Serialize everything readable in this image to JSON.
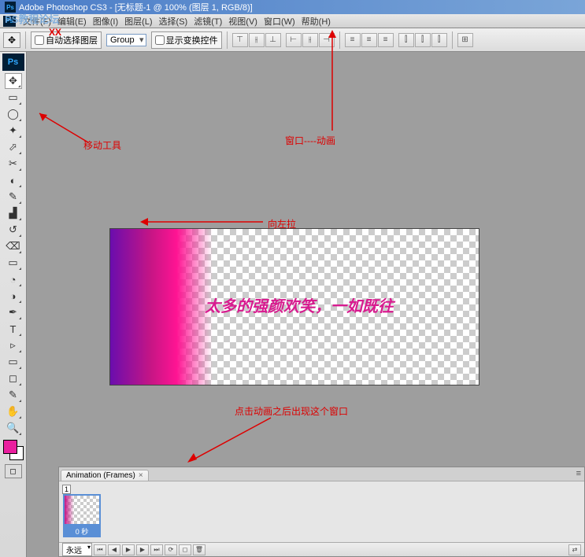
{
  "title_bar": {
    "text": "Adobe Photoshop CS3 - [无标题-1 @ 100% (图层 1, RGB/8)]"
  },
  "watermark": "PS教程论坛",
  "xx_label": "XX",
  "menu": {
    "items": [
      "文件(F)",
      "编辑(E)",
      "图像(I)",
      "图层(L)",
      "选择(S)",
      "滤镜(T)",
      "视图(V)",
      "窗口(W)",
      "帮助(H)"
    ]
  },
  "options_bar": {
    "auto_select_label": "自动选择图层",
    "group_select": "Group",
    "show_transform_label": "显示变换控件"
  },
  "tools": {
    "list": [
      "▣",
      "▥",
      "◇",
      "✦",
      "⬀",
      "✂",
      "✎",
      "⌫",
      "⟋",
      "⟍",
      "▟",
      "◐",
      "▭",
      "◆",
      "●",
      "◔",
      "◑",
      "✑",
      "T",
      "▹",
      "◻",
      "◢",
      "✋",
      "🔍"
    ]
  },
  "canvas_text": "太多的强颜欢笑，一如既往",
  "annotations": {
    "move_tool": "移动工具",
    "window_anim": "窗口----动画",
    "drag_left": "向左拉",
    "click_anim": "点击动画之后出现这个窗口"
  },
  "animation_panel": {
    "tab_label": "Animation (Frames)",
    "frame_number": "1",
    "frame_time": "0 秒",
    "loop_label": "永远"
  }
}
